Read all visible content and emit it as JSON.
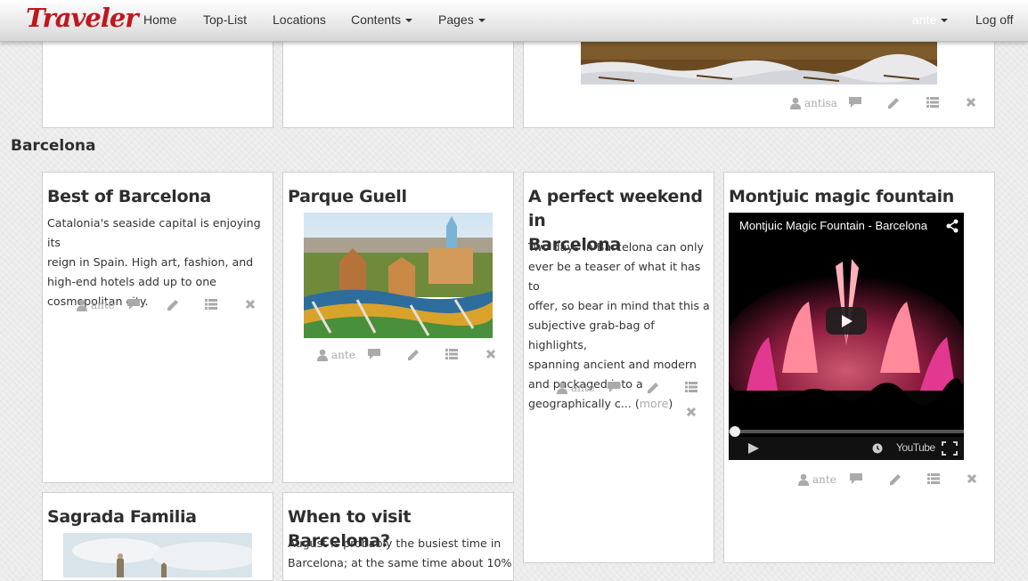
{
  "navbar": {
    "brand": "Traveler",
    "items": [
      "Home",
      "Top-List",
      "Locations",
      "Contents",
      "Pages"
    ],
    "user": "ante",
    "logoff": "Log off"
  },
  "top_row": {
    "author": "antisa"
  },
  "section": {
    "title": "Barcelona"
  },
  "cards": [
    {
      "title": "Best of Barcelona",
      "lines": [
        "Catalonia's seaside capital is enjoying its",
        "reign in Spain. High art, fashion, and",
        "high-end hotels add up to one",
        "cosmopolitan city."
      ],
      "author": "ante"
    },
    {
      "title": "Parque Guell",
      "author": "ante"
    },
    {
      "title_lines": [
        "A perfect weekend in",
        "Barcelona"
      ],
      "lines": [
        "Two days in Barcelona can only",
        "ever be a teaser of what it has to",
        "offer, so bear in mind that this a",
        "subjective grab-bag of highlights,",
        "spanning ancient and modern",
        "and packaged into a"
      ],
      "last_line": "geographically c... (",
      "more": "more",
      "close_paren": ")",
      "author": "ante"
    },
    {
      "title": "Montjuic magic fountain",
      "video_title": "Montjuic Magic Fountain - Barcelona",
      "video_brand": "YouTube",
      "author": "ante"
    },
    {
      "title": "Sagrada Familia"
    },
    {
      "title": "When to visit Barcelona?",
      "lines": [
        "August is probably the busiest time in",
        "Barcelona; at the same time about 10%"
      ]
    }
  ],
  "icons": {
    "author": "user-icon",
    "comment": "comment-icon",
    "edit": "pencil-icon",
    "list": "list-icon",
    "delete": "close-icon"
  },
  "colors": {
    "brand": "#c0161d",
    "icon": "#aaaaaa",
    "more_link": "#aaaaaa"
  }
}
